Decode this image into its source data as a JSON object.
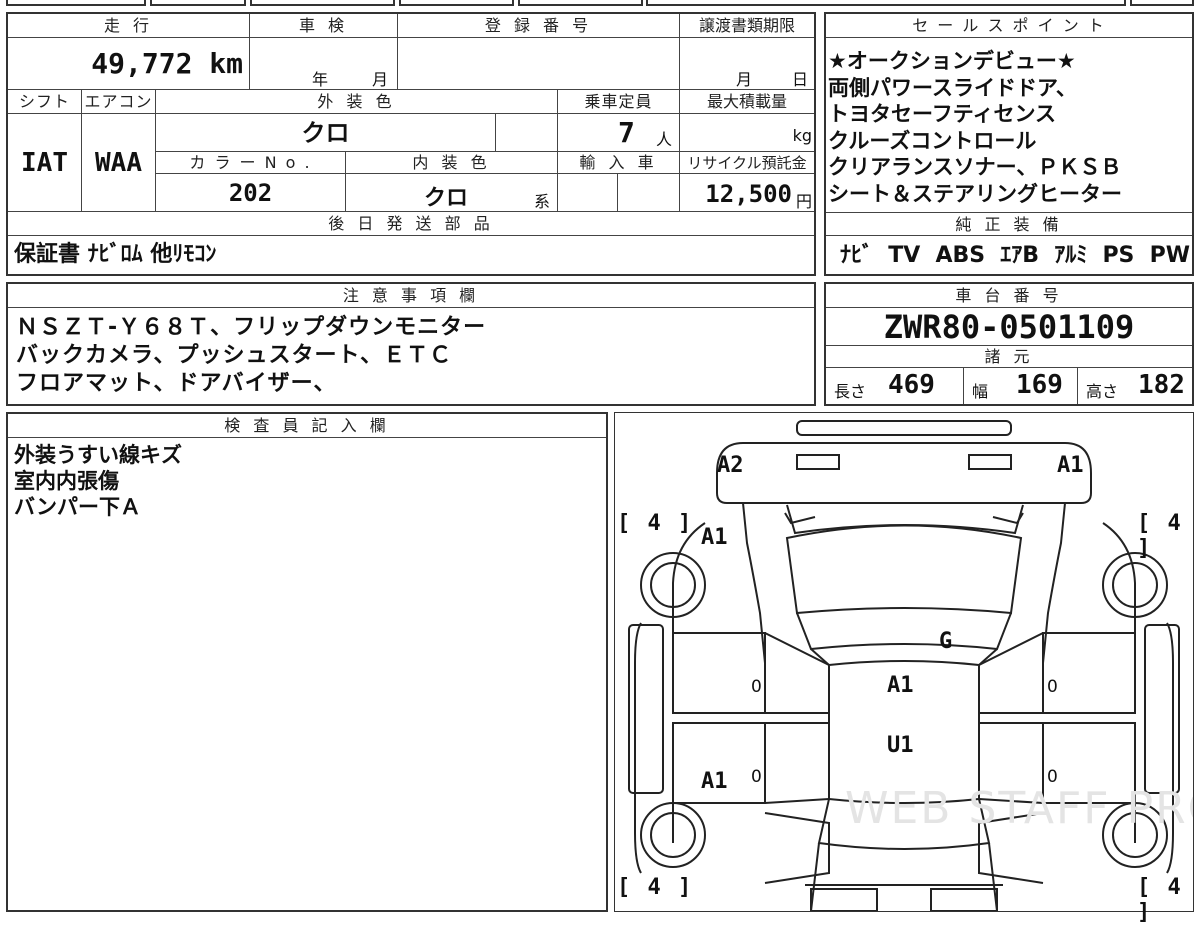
{
  "main_table": {
    "mileage_label": "走 行",
    "mileage_value": "49,772 km",
    "inspection_label": "車 検",
    "inspection_year_unit": "年",
    "inspection_month_unit": "月",
    "registration_label": "登 録 番 号",
    "transfer_label": "譲渡書類期限",
    "transfer_month_unit": "月",
    "transfer_day_unit": "日",
    "shift_label": "シフト",
    "shift_value": "IAT",
    "ac_label": "エアコン",
    "ac_value": "WAA",
    "exterior_color_label": "外 装 色",
    "exterior_color_value": "クロ",
    "capacity_label": "乗車定員",
    "capacity_value": "7",
    "capacity_unit": "人",
    "max_load_label": "最大積載量",
    "max_load_unit": "kg",
    "color_no_label": "カ ラ ー N o .",
    "color_no_value": "202",
    "interior_color_label": "内 装 色",
    "interior_color_value": "クロ",
    "interior_color_suffix": "系",
    "import_label": "輸 入 車",
    "recycle_label": "リサイクル預託金",
    "recycle_value": "12,500",
    "recycle_unit": "円"
  },
  "later_parts": {
    "label": "後 日 発 送 部 品",
    "value": "保証書 ﾅﾋﾞﾛﾑ 他ﾘﾓｺﾝ"
  },
  "sales_points": {
    "label": "セ ー ル ス ポ イ ン ト",
    "lines": [
      "★オークションデビュー★",
      "両側パワースライドドア、",
      "トヨタセーフティセンス",
      "クルーズコントロール",
      "クリアランスソナー、ＰＫＳＢ",
      "シート＆ステアリングヒーター"
    ]
  },
  "genuine_equipment": {
    "label": "純 正 装 備",
    "items": [
      "ﾅﾋﾞ",
      "TV",
      "ABS",
      "ｴｱB",
      "ｱﾙﾐ",
      "PS",
      "PW"
    ]
  },
  "notes": {
    "label": "注 意 事 項 欄",
    "lines": [
      "ＮＳＺＴ-Ｙ６８Ｔ、フリップダウンモニター",
      "バックカメラ、プッシュスタート、ＥＴＣ",
      "フロアマット、ドアバイザー、"
    ]
  },
  "chassis": {
    "label": "車 台 番 号",
    "value": "ZWR80-0501109"
  },
  "specs": {
    "label": "諸 元",
    "length_label": "長さ",
    "length_value": "469",
    "width_label": "幅",
    "width_value": "169",
    "height_label": "高さ",
    "height_value": "182"
  },
  "inspector": {
    "label": "検 査 員 記 入 欄",
    "lines": [
      "外装うすい線キズ",
      "室内内張傷",
      "バンパー下Ａ"
    ]
  },
  "diagram": {
    "tire_tread_left_top": "[ 4 ]",
    "tire_tread_right_top": "[ 4 ]",
    "tire_tread_left_bottom": "[ 4 ]",
    "tire_tread_right_bottom": "[ 4 ]",
    "marks": {
      "front_left_corner": "A2",
      "front_right_corner": "A1",
      "left_front_fender": "A1",
      "windshield": "G",
      "roof_front": "A1",
      "roof_rear": "U1",
      "left_rear_fender": "A1",
      "door_lf": "0",
      "door_lr": "0",
      "door_rf": "0",
      "door_rr": "0"
    },
    "watermark": "WEB STAFF PRO"
  }
}
